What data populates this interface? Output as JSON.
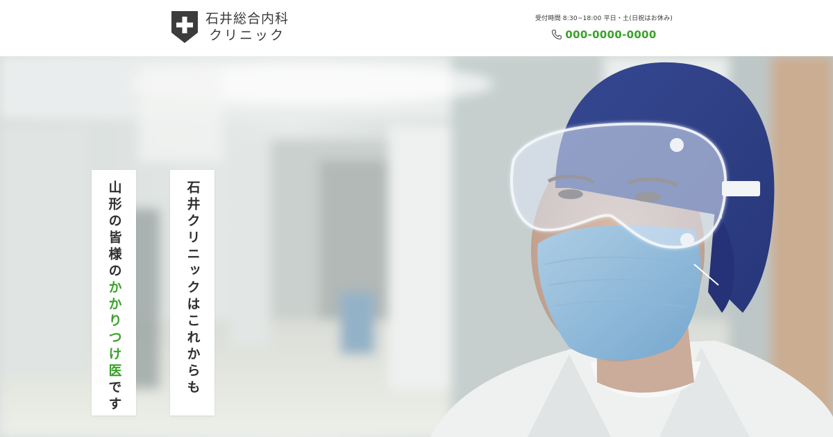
{
  "header": {
    "clinic_name_line1": "石井総合内科",
    "clinic_name_line2": "クリニック",
    "hours": "受付時間 8:30~18:00 平日・土(日祝はお休み)",
    "phone": "000-0000-0000"
  },
  "hero": {
    "copy_left_before": "山形の皆様の",
    "copy_left_accent": "かかりつけ医",
    "copy_left_after": "です",
    "copy_right": "石井クリニックはこれからも"
  },
  "colors": {
    "accent": "#3ba22a",
    "logo_shield": "#3c3c3c",
    "text": "#2e2e2e"
  },
  "icons": [
    "shield-cross-logo",
    "phone-icon"
  ]
}
